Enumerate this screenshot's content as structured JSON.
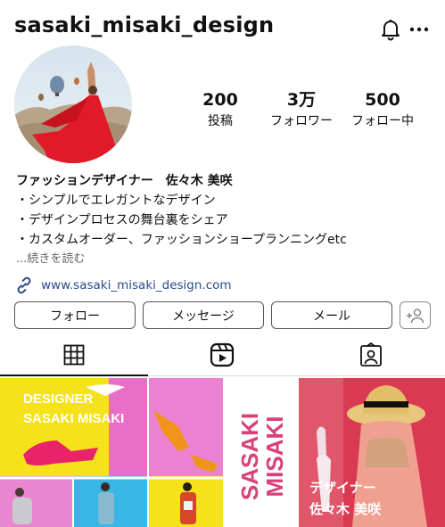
{
  "header": {
    "username": "sasaki_misaki_design",
    "bell_icon": "bell-icon",
    "more_icon": "more-dots-icon"
  },
  "stats": [
    {
      "value": "200",
      "label": "投稿"
    },
    {
      "value": "3万",
      "label": "フォロワー"
    },
    {
      "value": "500",
      "label": "フォロー中"
    }
  ],
  "bio": {
    "name": "ファッションデザイナー　佐々木 美咲",
    "lines": [
      "・シンプルでエレガントなデザイン",
      "・デザインプロセスの舞台裏をシェア",
      "・カスタムオーダー、ファッションショープランニングetc"
    ],
    "more_label": "...続きを読む"
  },
  "link": {
    "icon": "link-icon",
    "text": "www.sasaki_misaki_design.com"
  },
  "actions": {
    "follow_label": "フォロー",
    "message_label": "メッセージ",
    "email_label": "メール",
    "add_user_icon": "add-user-icon"
  },
  "tabs": [
    {
      "icon": "grid-icon",
      "active": true
    },
    {
      "icon": "reels-icon",
      "active": false
    },
    {
      "icon": "tagged-icon",
      "active": false
    }
  ],
  "posts": {
    "tile1_text": [
      "DESIGNER",
      "SASAKI MISAKI"
    ],
    "tile2_text": [
      "SASAKI",
      "MISAKI"
    ],
    "tile3_text": [
      "デザイナー",
      "佐々木 美咲"
    ]
  },
  "colors": {
    "link": "#2a4a8a",
    "yellow": "#f5e21a",
    "pink": "#e86ec8",
    "magenta": "#d8417a",
    "red_dress": "#e11a2a"
  }
}
